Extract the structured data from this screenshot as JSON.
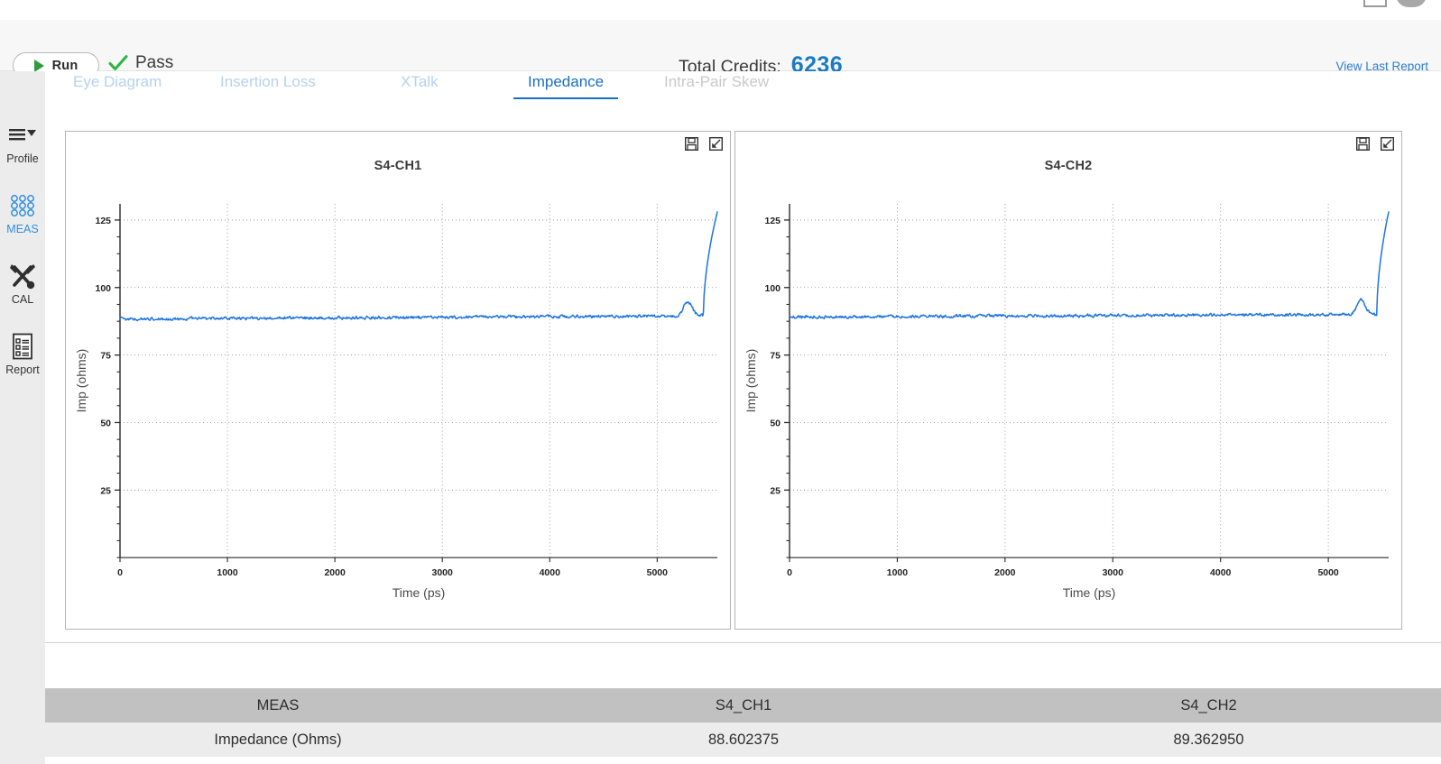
{
  "window": {
    "restore_icon": "restore-window-icon",
    "close_icon": "close-window-icon"
  },
  "toolbar": {
    "run_label": "Run",
    "run_icon": "play-icon",
    "status_icon": "check-icon",
    "status_text": "Pass",
    "credits_label": "Total Credits:",
    "credits_value": "6236",
    "view_last_report": "View Last Report",
    "accent_blue": "#1a7bc4",
    "pass_green": "#2e9b3f"
  },
  "sidebar": {
    "items": [
      {
        "label": "Profile",
        "icon": "menu-dropdown-icon",
        "active": false
      },
      {
        "label": "MEAS",
        "icon": "grid-dots-icon",
        "active": true
      },
      {
        "label": "CAL",
        "icon": "tools-icon",
        "active": false
      },
      {
        "label": "Report",
        "icon": "report-doc-icon",
        "active": false
      }
    ]
  },
  "tabs": [
    {
      "label": "Eye Diagram",
      "state": "inactive"
    },
    {
      "label": "Insertion Loss",
      "state": "inactive"
    },
    {
      "label": "XTalk",
      "state": "inactive"
    },
    {
      "label": "Impedance",
      "state": "active"
    },
    {
      "label": "Intra-Pair Skew",
      "state": "muted"
    }
  ],
  "panels": [
    {
      "title": "S4-CH1",
      "save_icon": "save-icon",
      "expand_icon": "expand-icon"
    },
    {
      "title": "S4-CH2",
      "save_icon": "save-icon",
      "expand_icon": "expand-icon"
    }
  ],
  "table": {
    "headers": [
      "MEAS",
      "S4_CH1",
      "S4_CH2"
    ],
    "rows": [
      [
        "Impedance (Ohms)",
        "88.602375",
        "89.362950"
      ]
    ]
  },
  "chart_data": [
    {
      "type": "line",
      "title": "S4-CH1",
      "xlabel": "Time (ps)",
      "ylabel": "Imp (ohms)",
      "xlim": [
        0,
        5560
      ],
      "ylim": [
        0,
        131
      ],
      "xticks": [
        0,
        1000,
        2000,
        3000,
        4000,
        5000
      ],
      "yticks": [
        25,
        50,
        75,
        100,
        125
      ],
      "grid": true,
      "line_color": "#1f74e0",
      "mean_impedance": 88.602375,
      "baseline": 88.3,
      "noise_amplitude": 1.0,
      "drift_end": 89.6,
      "bump_x": 5280,
      "bump_y": 92.5,
      "spike_start_x": 5430,
      "spike_peak_y": 128
    },
    {
      "type": "line",
      "title": "S4-CH2",
      "xlabel": "Time (ps)",
      "ylabel": "Imp (ohms)",
      "xlim": [
        0,
        5560
      ],
      "ylim": [
        0,
        131
      ],
      "xticks": [
        0,
        1000,
        2000,
        3000,
        4000,
        5000
      ],
      "yticks": [
        25,
        50,
        75,
        100,
        125
      ],
      "grid": true,
      "line_color": "#1f74e0",
      "mean_impedance": 89.36295,
      "baseline": 89.1,
      "noise_amplitude": 1.0,
      "drift_end": 90.1,
      "bump_x": 5300,
      "bump_y": 93.0,
      "spike_start_x": 5450,
      "spike_peak_y": 128
    }
  ]
}
